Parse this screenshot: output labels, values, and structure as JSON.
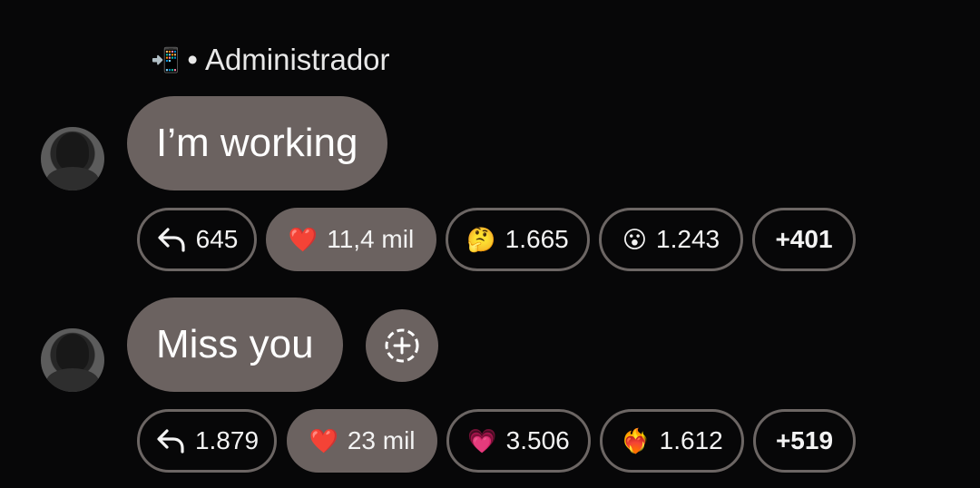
{
  "sender": {
    "device_emoji": "📲",
    "separator": "•",
    "role": "Administrador"
  },
  "messages": [
    {
      "text": "I’m working",
      "reactions": {
        "reply": {
          "icon": "reply-arrow-icon",
          "count": "645"
        },
        "items": [
          {
            "emoji": "❤️",
            "icon": "red-heart-icon",
            "count": "11,4 mil",
            "selected": true
          },
          {
            "emoji": "🤔",
            "icon": "thinking-face-icon",
            "count": "1.665",
            "selected": false
          },
          {
            "emoji": "😮",
            "icon": "surprised-face-icon",
            "count": "1.243",
            "selected": false
          }
        ],
        "more": "+401"
      }
    },
    {
      "text": "Miss you",
      "reactions": {
        "reply": {
          "icon": "reply-arrow-icon",
          "count": "1.879"
        },
        "items": [
          {
            "emoji": "❤️",
            "icon": "red-heart-icon",
            "count": "23 mil",
            "selected": true
          },
          {
            "emoji": "💗",
            "icon": "growing-heart-icon",
            "count": "3.506",
            "selected": false
          },
          {
            "emoji": "❤️‍🔥",
            "icon": "heart-on-fire-icon",
            "count": "1.612",
            "selected": false
          }
        ],
        "more": "+519"
      }
    }
  ],
  "colors": {
    "background": "#070708",
    "bubble": "#6b6260",
    "pill_border": "#6c6664",
    "text": "#ffffff"
  }
}
